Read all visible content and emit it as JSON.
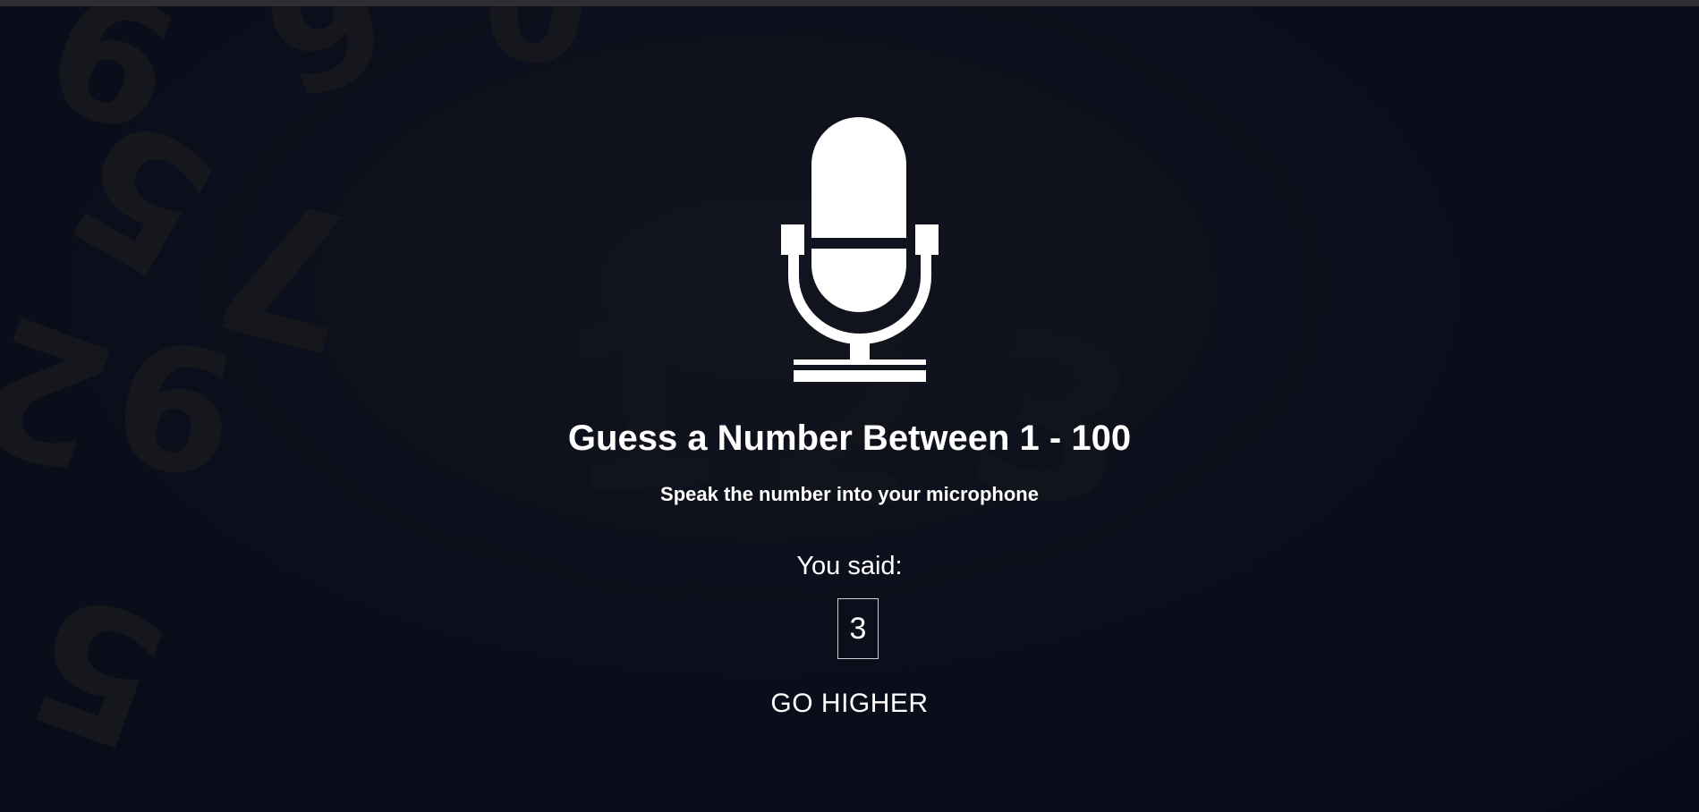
{
  "background": {
    "color": "#0b0e1a",
    "decoration": "scattered-digits"
  },
  "header": {
    "title": "Guess a Number Between 1 - 100",
    "subtitle": "Speak the number into your microphone"
  },
  "icon": {
    "name": "microphone-icon",
    "color": "#ffffff"
  },
  "response": {
    "label": "You said:",
    "value": "3",
    "message": "GO HIGHER"
  }
}
